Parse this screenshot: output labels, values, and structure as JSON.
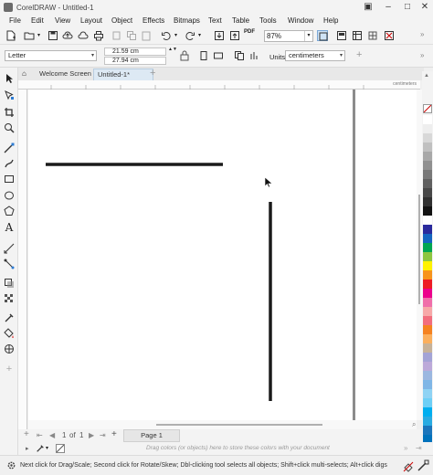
{
  "window": {
    "title": "CorelDRAW - Untitled-1"
  },
  "menu": [
    "File",
    "Edit",
    "View",
    "Layout",
    "Object",
    "Effects",
    "Bitmaps",
    "Text",
    "Table",
    "Tools",
    "Window",
    "Help"
  ],
  "toolbar": {
    "zoom": "87%",
    "pdf_label": "PDF"
  },
  "property_bar": {
    "page_size": "Letter",
    "width": "21.59 cm",
    "height": "27.94 cm",
    "units_label": "Units:",
    "units_value": "centimeters"
  },
  "doc_tabs": [
    {
      "label": "Welcome Screen",
      "active": false
    },
    {
      "label": "Untitled-1*",
      "active": true
    }
  ],
  "ruler": {
    "unit": "centimeters"
  },
  "page_nav": {
    "current": "1",
    "of_label": "of",
    "total": "1",
    "page_tab": "Page 1"
  },
  "color_bar": {
    "hint": "Drag colors (or objects) here to store these colors with your document"
  },
  "status": {
    "message": "Next click for Drag/Scale; Second click for Rotate/Skew; Dbl-clicking tool selects all objects; Shift+click multi-selects; Alt+click digs"
  },
  "palette": [
    "#ffffff",
    "#eeeeee",
    "#d8d8d8",
    "#c0c0c0",
    "#a8a8a8",
    "#909090",
    "#787878",
    "#606060",
    "#484848",
    "#303030",
    "#111111",
    "#ffffff",
    "#2a2a9c",
    "#1565c0",
    "#00a651",
    "#8dc63f",
    "#fff200",
    "#f7941d",
    "#ed1c24",
    "#ec008c",
    "#f06eaa",
    "#f7a8a8",
    "#f26d7d",
    "#f58220",
    "#fbaf5d",
    "#c7b299",
    "#a3a3d6",
    "#bca9d9",
    "#9bb7e0",
    "#7fb6e6",
    "#8fd3f4",
    "#6dcff6",
    "#00aeef",
    "#29abe2",
    "#1b75bc",
    "#0072bc"
  ]
}
